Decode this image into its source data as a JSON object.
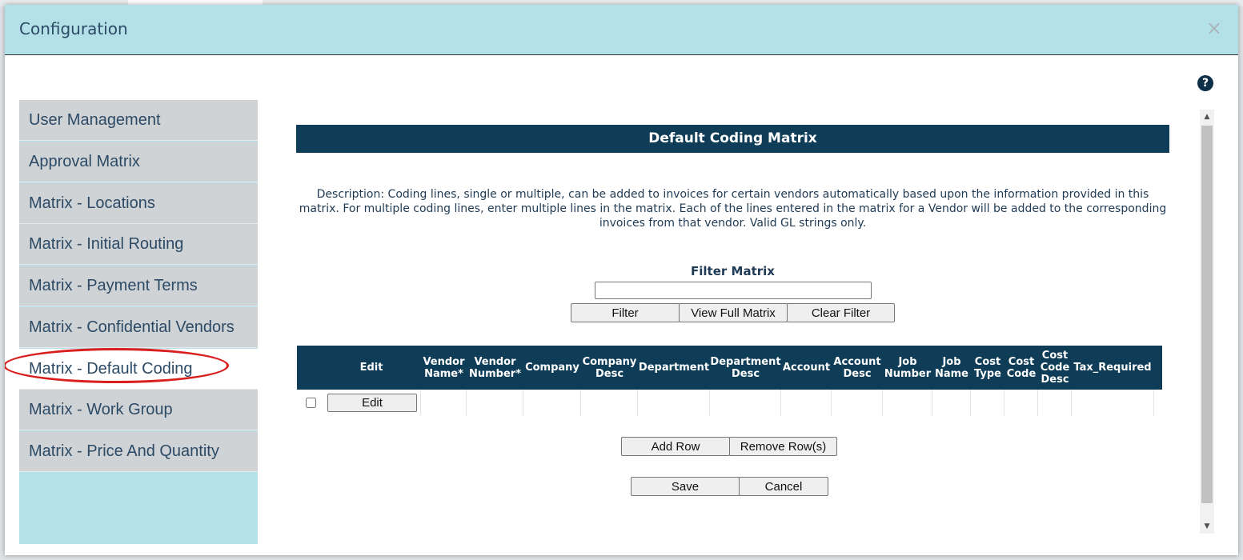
{
  "modal": {
    "title": "Configuration",
    "close_icon": "×",
    "help_icon": "?"
  },
  "sidebar": {
    "items": [
      {
        "label": "User Management",
        "active": false
      },
      {
        "label": "Approval Matrix",
        "active": false
      },
      {
        "label": "Matrix - Locations",
        "active": false
      },
      {
        "label": "Matrix - Initial Routing",
        "active": false
      },
      {
        "label": "Matrix - Payment Terms",
        "active": false
      },
      {
        "label": "Matrix - Confidential Vendors",
        "active": false
      },
      {
        "label": "Matrix - Default Coding",
        "active": true
      },
      {
        "label": "Matrix - Work Group",
        "active": false
      },
      {
        "label": "Matrix - Price And Quantity",
        "active": false
      }
    ]
  },
  "main": {
    "title": "Default Coding Matrix",
    "description": "Description: Coding lines, single or multiple, can be added to invoices for certain vendors automatically based upon the information provided in this matrix. For multiple coding lines, enter multiple lines in the matrix. Each of the lines entered in the matrix for a Vendor will be added to the corresponding invoices from that vendor. Valid GL strings only.",
    "filter": {
      "label": "Filter Matrix",
      "value": "",
      "filter_button": "Filter",
      "view_full_button": "View Full Matrix",
      "clear_button": "Clear Filter"
    },
    "grid": {
      "columns": [
        "",
        "Edit",
        "Vendor Name*",
        "Vendor Number*",
        "Company",
        "Company Desc",
        "Department",
        "Department Desc",
        "Account",
        "Account Desc",
        "Job Number",
        "Job Name",
        "Cost Type",
        "Cost Code",
        "Cost Code Desc",
        "Tax_Required"
      ],
      "rows": [
        {
          "checked": false,
          "edit_label": "Edit"
        }
      ]
    },
    "actions": {
      "add_row": "Add Row",
      "remove_rows": "Remove Row(s)",
      "save": "Save",
      "cancel": "Cancel"
    }
  },
  "colors": {
    "header_bg": "#b4e0e8",
    "title_bar_bg": "#0f3d57",
    "nav_bg": "#cfd3d5",
    "nav_text": "#2c4a66",
    "annotation": "#d91e1e"
  }
}
